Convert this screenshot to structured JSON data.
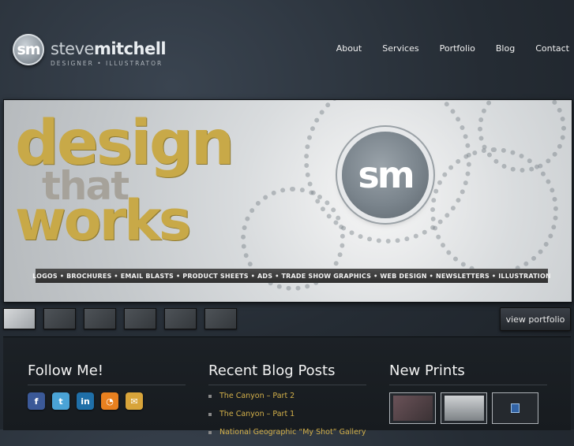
{
  "header": {
    "logo_mark": "sm",
    "logo_name_light": "steve",
    "logo_name_bold": "mitchell",
    "logo_tagline": "DESIGNER • ILLUSTRATOR"
  },
  "nav": [
    {
      "label": "About"
    },
    {
      "label": "Services"
    },
    {
      "label": "Portfolio"
    },
    {
      "label": "Blog"
    },
    {
      "label": "Contact"
    }
  ],
  "hero": {
    "word1": "design",
    "word2": "that",
    "word3": "works",
    "badge": "sm",
    "strip": "LOGOS • BROCHURES • EMAIL BLASTS • PRODUCT SHEETS • ADS • TRADE SHOW GRAPHICS • WEB DESIGN • NEWSLETTERS • ILLUSTRATION"
  },
  "slider": {
    "view_label": "view portfolio",
    "thumbnail_count": 6,
    "active_index": 0
  },
  "follow": {
    "title": "Follow Me!",
    "icons": [
      "facebook-icon",
      "twitter-icon",
      "linkedin-icon",
      "rss-icon",
      "email-icon"
    ]
  },
  "blog": {
    "title": "Recent Blog Posts",
    "posts": [
      {
        "title": "The Canyon – Part 2"
      },
      {
        "title": "The Canyon – Part 1"
      },
      {
        "title": "National Geographic “My Shot” Gallery"
      }
    ]
  },
  "prints": {
    "title": "New Prints"
  },
  "colors": {
    "gold": "#c8a948",
    "link_gold": "#d3b04a",
    "background": "#252c34"
  }
}
